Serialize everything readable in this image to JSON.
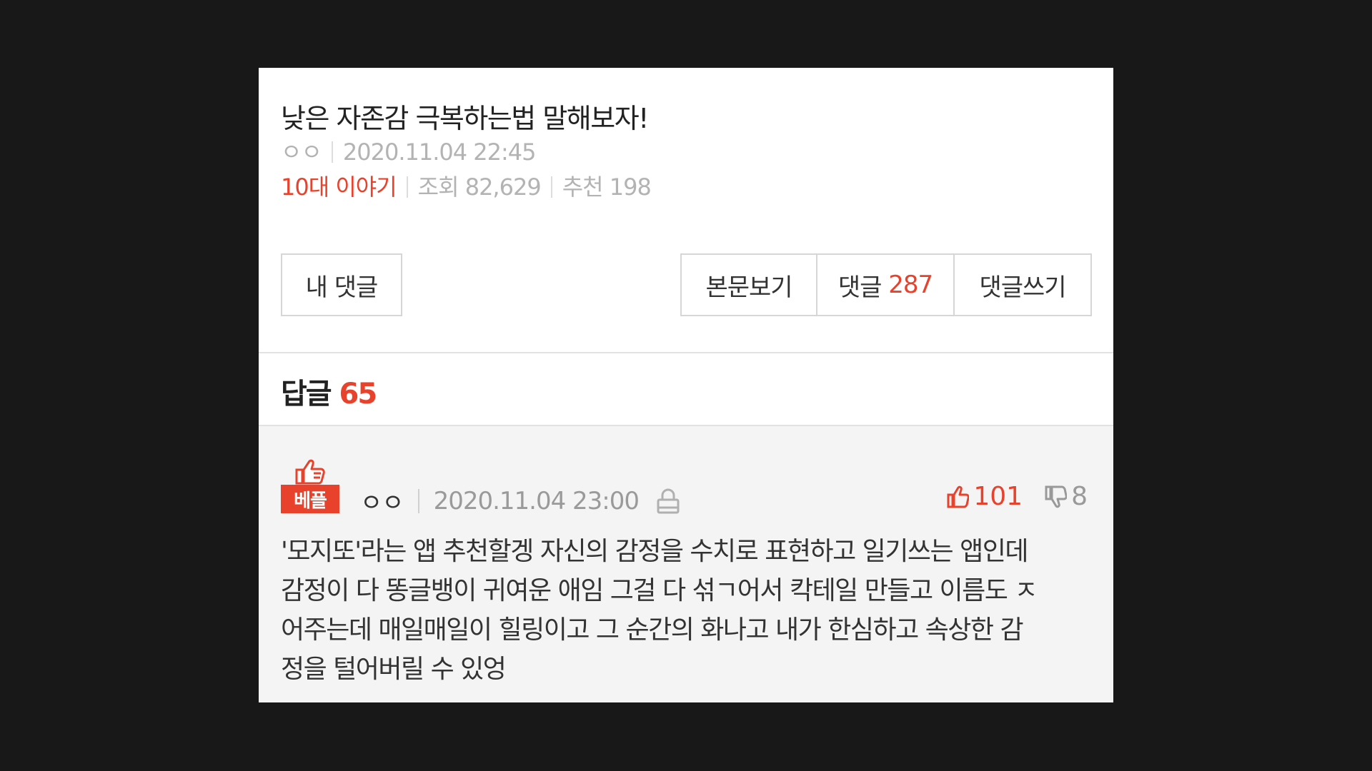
{
  "post": {
    "title": "낮은 자존감 극복하는법 말해보자!",
    "author": "ㅇㅇ",
    "date": "2020.11.04 22:45",
    "category": "10대 이야기",
    "views": "조회 82,629",
    "recommends": "추천 198"
  },
  "actions": {
    "my_comments_label": "내 댓글",
    "view_body_label": "본문보기",
    "comments_label": "댓글",
    "comments_count": "287",
    "write_comment_label": "댓글쓰기"
  },
  "replies": {
    "label": "답글",
    "count": "65"
  },
  "comment": {
    "badge_label": "베플",
    "author": "ㅇㅇ",
    "date": "2020.11.04 23:00",
    "upvotes": "101",
    "downvotes": "8",
    "body_lines": [
      "'모지또'라는 앱 추천할겡 자신의 감정을 수치로 표현하고 일기쓰는 앱인데",
      "감정이 다 똥글뱅이 귀여운 애임 그걸 다 섞ㄱ어서 칵테일 만들고 이름도 ㅈ",
      "어주는데 매일매일이 힐링이고 그 순간의 화나고 내가 한심하고 속상한 감",
      "정을 털어버릴 수 있엉"
    ]
  },
  "colors": {
    "accent": "#e8412c",
    "background": "#181818",
    "comment_bg": "#f4f4f4"
  }
}
